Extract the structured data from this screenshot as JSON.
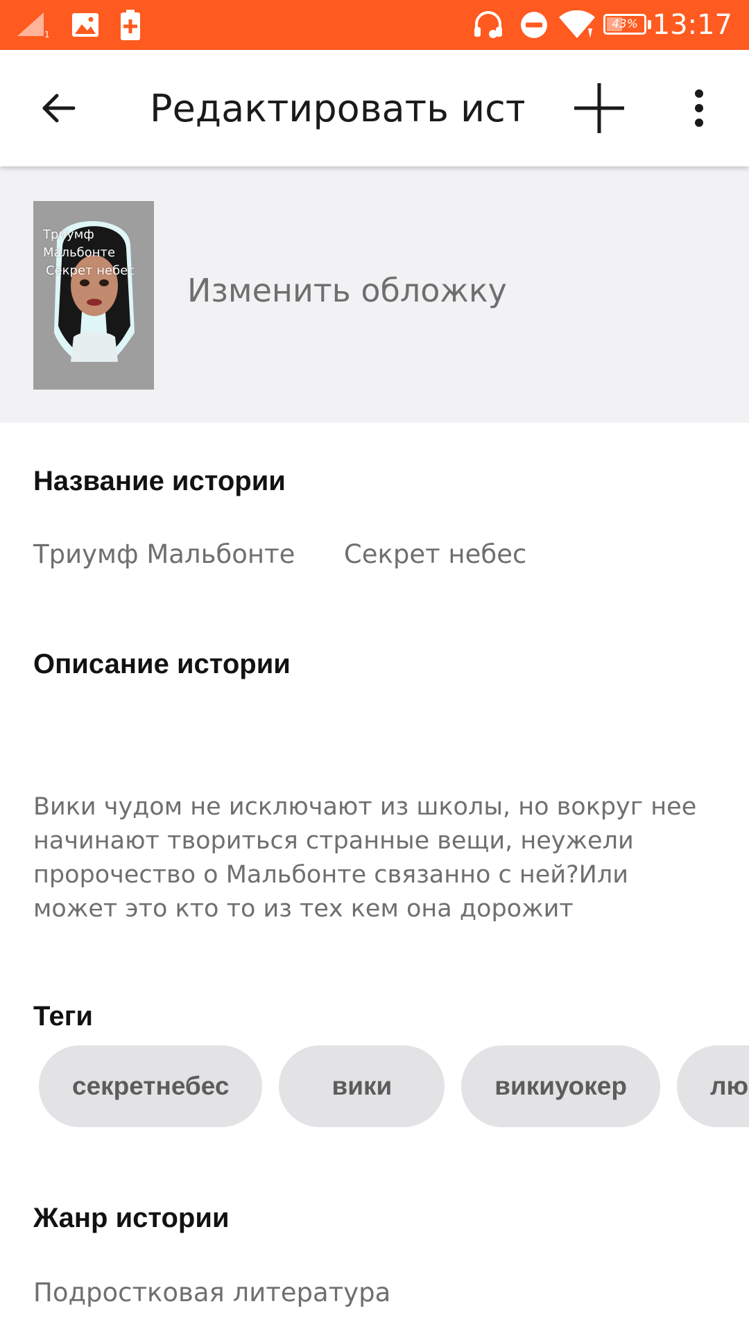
{
  "status_bar": {
    "time": "13:17",
    "battery_text": "43%",
    "battery_level": 0.43,
    "background_color": "#FF5A1F",
    "icons": [
      "signal-icon",
      "image-notification-icon",
      "battery-saver-icon",
      "headset-icon",
      "do-not-disturb-icon",
      "wifi-icon",
      "battery-icon"
    ]
  },
  "app_bar": {
    "back_icon": "arrow-left-icon",
    "title": "Редактировать исто…",
    "add_icon": "plus-icon",
    "menu_icon": "more-vert-icon"
  },
  "cover": {
    "thumbnail_lines": [
      "Триумф",
      "Мальбонте",
      "Секрет небес"
    ],
    "change_label": "Изменить обложку"
  },
  "story_title": {
    "heading": "Название истории",
    "value": "Триумф Мальбонте      Секрет небес"
  },
  "story_description": {
    "heading": "Описание истории",
    "value": "Вики чудом не исключают из школы, но вокруг нее начинают твориться странные вещи, неужели пророчество о Мальбонте связанно с ней?Или может это кто то из тех кем она дорожит"
  },
  "tags": {
    "heading": "Теги",
    "items": [
      "секретнебес",
      "вики",
      "викиуокер",
      "люци"
    ]
  },
  "genre": {
    "heading": "Жанр истории",
    "value": "Подростковая литература"
  }
}
